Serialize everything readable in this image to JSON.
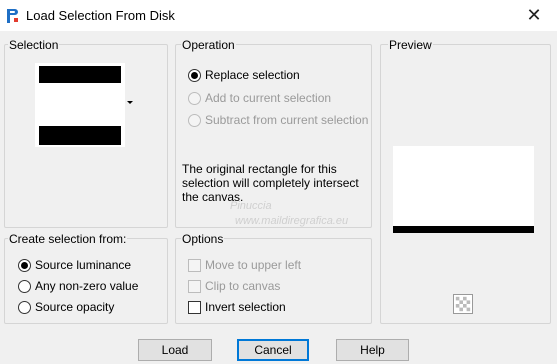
{
  "window": {
    "title": "Load Selection From Disk",
    "close_glyph": "✕"
  },
  "selection": {
    "label": "Selection"
  },
  "operation": {
    "label": "Operation",
    "options": [
      {
        "label": "Replace selection",
        "checked": true,
        "enabled": true
      },
      {
        "label": "Add to current selection",
        "checked": false,
        "enabled": false
      },
      {
        "label": "Subtract from current selection",
        "checked": false,
        "enabled": false
      }
    ],
    "info": "The original rectangle for this selection will completely intersect the canvas."
  },
  "preview": {
    "label": "Preview"
  },
  "create_from": {
    "label": "Create selection from:",
    "options": [
      {
        "label": "Source luminance",
        "checked": true
      },
      {
        "label": "Any non-zero value",
        "checked": false
      },
      {
        "label": "Source opacity",
        "checked": false
      }
    ]
  },
  "options": {
    "label": "Options",
    "items": [
      {
        "label": "Move to upper left",
        "checked": false,
        "enabled": false
      },
      {
        "label": "Clip to canvas",
        "checked": false,
        "enabled": false
      },
      {
        "label": "Invert selection",
        "checked": false,
        "enabled": true
      }
    ]
  },
  "watermark": {
    "line1": "Pinuccia",
    "line2": "www.maildiregrafica.eu"
  },
  "buttons": {
    "load": "Load",
    "cancel": "Cancel",
    "help": "Help"
  }
}
